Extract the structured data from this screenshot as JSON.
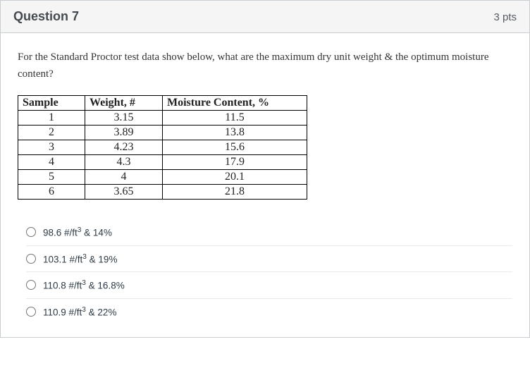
{
  "header": {
    "title": "Question 7",
    "points": "3 pts"
  },
  "prompt": "For the Standard Proctor test data show below, what are the maximum dry unit weight & the optimum moisture content?",
  "table": {
    "headers": [
      "Sample",
      "Weight, #",
      "Moisture Content, %"
    ],
    "rows": [
      [
        "1",
        "3.15",
        "11.5"
      ],
      [
        "2",
        "3.89",
        "13.8"
      ],
      [
        "3",
        "4.23",
        "15.6"
      ],
      [
        "4",
        "4.3",
        "17.9"
      ],
      [
        "5",
        "4",
        "20.1"
      ],
      [
        "6",
        "3.65",
        "21.8"
      ]
    ]
  },
  "answers": [
    {
      "html": "98.6 #/ft<sup>3</sup> & 14%"
    },
    {
      "html": "103.1 #/ft<sup>3</sup> & 19%"
    },
    {
      "html": "110.8 #/ft<sup>3</sup> & 16.8%"
    },
    {
      "html": "110.9 #/ft<sup>3</sup> & 22%"
    }
  ]
}
